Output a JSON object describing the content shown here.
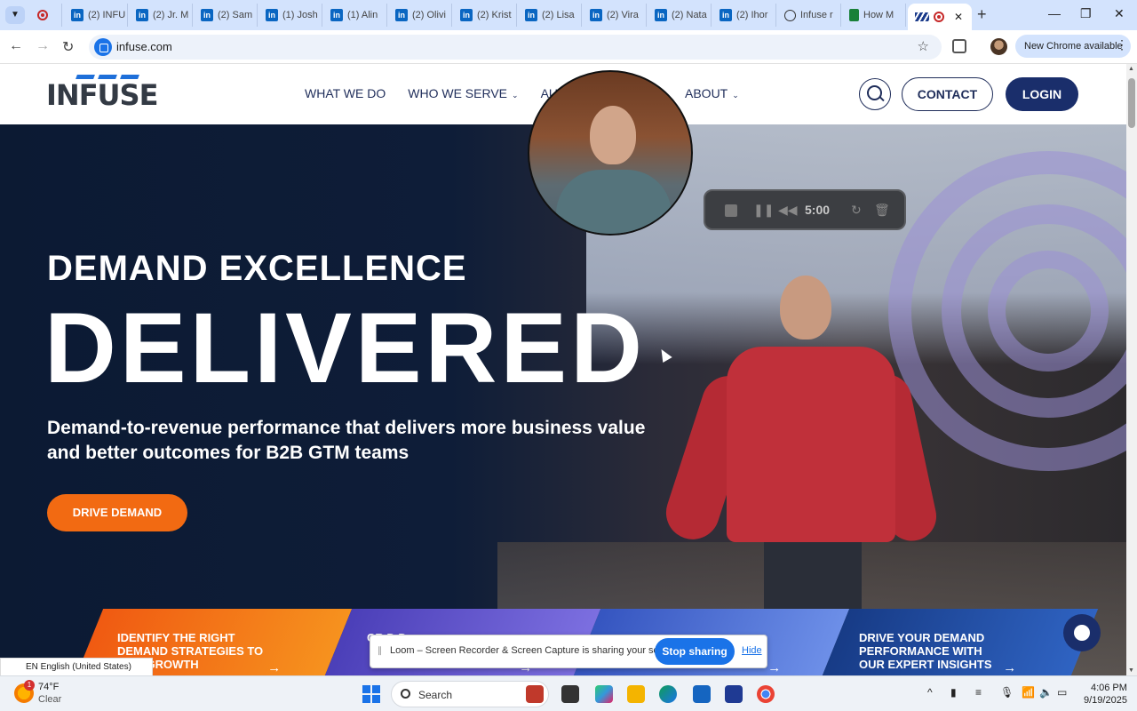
{
  "browser": {
    "tabs": [
      {
        "label": "",
        "icon": "record-icon"
      },
      {
        "label": "(2) INFU",
        "icon": "linkedin-icon"
      },
      {
        "label": "(2) Jr. M",
        "icon": "linkedin-icon"
      },
      {
        "label": "(2) Sam",
        "icon": "linkedin-icon"
      },
      {
        "label": "(1) Josh",
        "icon": "linkedin-icon"
      },
      {
        "label": "(1) Alin",
        "icon": "linkedin-icon"
      },
      {
        "label": "(2) Olivi",
        "icon": "linkedin-icon"
      },
      {
        "label": "(2) Krist",
        "icon": "linkedin-icon"
      },
      {
        "label": "(2) Lisa",
        "icon": "linkedin-icon"
      },
      {
        "label": "(2) Vira",
        "icon": "linkedin-icon"
      },
      {
        "label": "(2) Nata",
        "icon": "linkedin-icon"
      },
      {
        "label": "(2) Ihor",
        "icon": "linkedin-icon"
      },
      {
        "label": "Infuse r",
        "icon": "globe-icon"
      },
      {
        "label": "How M",
        "icon": "sheets-icon"
      },
      {
        "label": "",
        "icon": "loom-icon",
        "active": true
      }
    ],
    "url": "infuse.com",
    "update_label": "New Chrome available"
  },
  "site": {
    "logo_text": "INFUSE",
    "nav": [
      {
        "label": "WHAT WE DO",
        "caret": false
      },
      {
        "label": "WHO WE SERVE",
        "caret": true
      },
      {
        "label": "AUDIEN",
        "caret": false
      },
      {
        "label": "ABOUT",
        "caret": true
      }
    ],
    "contact_label": "CONTACT",
    "login_label": "LOGIN"
  },
  "hero": {
    "eyebrow": "DEMAND EXCELLENCE",
    "title": "DELIVERED",
    "subtitle": "Demand-to-revenue performance that delivers more business value and better outcomes for B2B GTM teams",
    "cta_label": "DRIVE DEMAND",
    "cards": [
      {
        "label": "IDENTIFY THE RIGHT DEMAND STRATEGIES TO OUR GROWTH",
        "color": "#f27a1a"
      },
      {
        "label": "CR D D",
        "color": "#5a4fc4"
      },
      {
        "label": "",
        "color": "#3d5fc9"
      },
      {
        "label": "DRIVE YOUR DEMAND PERFORMANCE WITH OUR EXPERT INSIGHTS",
        "color": "#1f4a9e"
      }
    ]
  },
  "recorder": {
    "timer": "5:00"
  },
  "share_bar": {
    "message": "Loom – Screen Recorder & Screen Capture is sharing your screen.",
    "stop_label": "Stop sharing",
    "hide_label": "Hide"
  },
  "language": {
    "label": "EN English (United States)"
  },
  "taskbar": {
    "weather_badge": "1",
    "temperature": "74°F",
    "condition": "Clear",
    "search_label": "Search",
    "time": "4:06 PM",
    "date": "9/19/2025"
  },
  "colors": {
    "brand_navy": "#1a2e6b",
    "cta_orange": "#f26a12",
    "share_blue": "#1a73e8"
  }
}
